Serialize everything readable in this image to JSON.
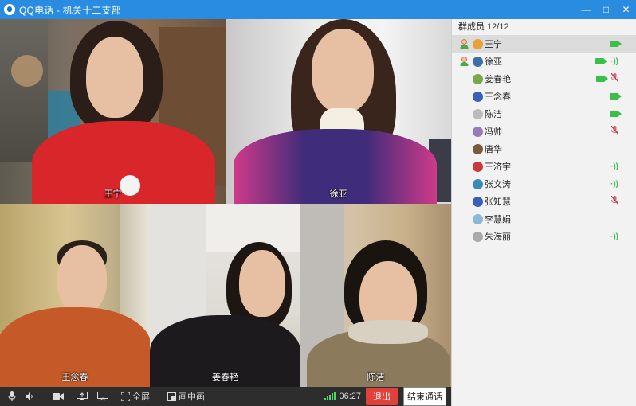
{
  "window": {
    "title": "QQ电话 - 机关十二支部",
    "min_label": "—",
    "max_label": "□",
    "close_label": "✕"
  },
  "videos": [
    {
      "name": "王宁"
    },
    {
      "name": "徐亚"
    },
    {
      "name": "王念春"
    },
    {
      "name": "姜春艳"
    },
    {
      "name": "陈洁"
    }
  ],
  "panel": {
    "header": "群成员 12/12",
    "members": [
      {
        "name": "王宁",
        "host": true,
        "camera": true,
        "speaking": false,
        "muted": false,
        "avatar_color": "#e8a13a"
      },
      {
        "name": "徐亚",
        "host": true,
        "camera": true,
        "speaking": true,
        "muted": false,
        "avatar_color": "#3a6fa8"
      },
      {
        "name": "姜春艳",
        "host": false,
        "camera": true,
        "speaking": false,
        "muted": true,
        "avatar_color": "#7aa84a"
      },
      {
        "name": "王念春",
        "host": false,
        "camera": true,
        "speaking": false,
        "muted": false,
        "avatar_color": "#3a5fb8"
      },
      {
        "name": "陈洁",
        "host": false,
        "camera": true,
        "speaking": false,
        "muted": false,
        "avatar_color": "#bbbbbb"
      },
      {
        "name": "冯帅",
        "host": false,
        "camera": false,
        "speaking": false,
        "muted": true,
        "avatar_color": "#9a7ab8"
      },
      {
        "name": "唐华",
        "host": false,
        "camera": false,
        "speaking": false,
        "muted": false,
        "avatar_color": "#7a5a3a"
      },
      {
        "name": "王济宇",
        "host": false,
        "camera": false,
        "speaking": true,
        "muted": false,
        "avatar_color": "#c83a3a"
      },
      {
        "name": "张文涛",
        "host": false,
        "camera": false,
        "speaking": true,
        "muted": false,
        "avatar_color": "#3a8ab8"
      },
      {
        "name": "张知慧",
        "host": false,
        "camera": false,
        "speaking": false,
        "muted": true,
        "avatar_color": "#3a5fb8"
      },
      {
        "name": "李慧娟",
        "host": false,
        "camera": false,
        "speaking": false,
        "muted": false,
        "avatar_color": "#8ab8d8"
      },
      {
        "name": "朱海丽",
        "host": false,
        "camera": false,
        "speaking": true,
        "muted": false,
        "avatar_color": "#aaaaaa"
      }
    ]
  },
  "toolbar": {
    "fullscreen_label": "全屏",
    "pip_label": "画中画",
    "timer": "06:27",
    "exit_label": "退出",
    "end_call_label": "结束通话"
  }
}
